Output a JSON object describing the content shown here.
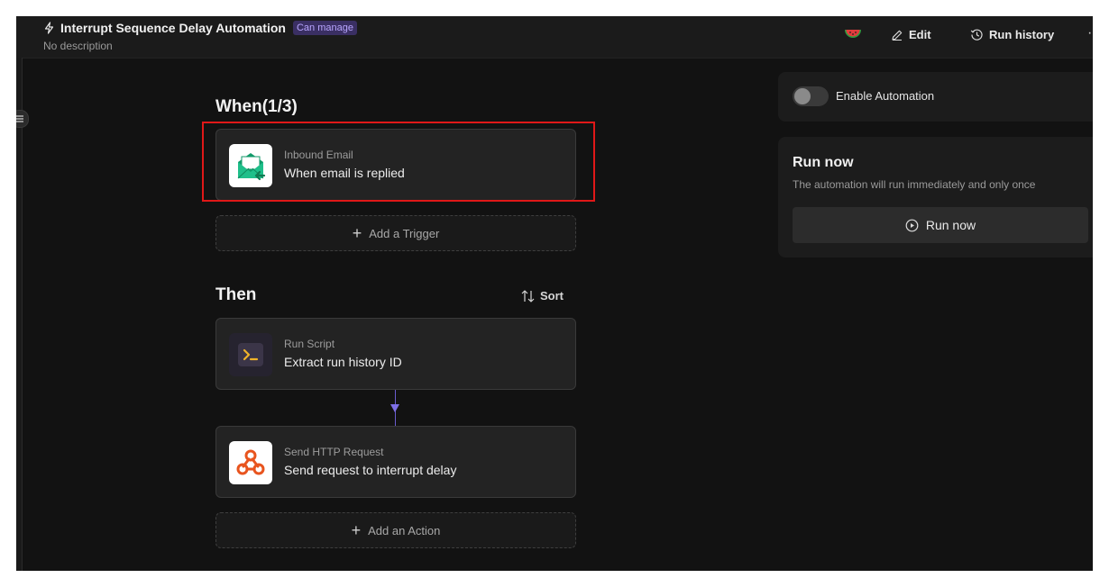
{
  "header": {
    "title": "Interrupt Sequence Delay Automation",
    "badge": "Can manage",
    "subtitle": "No description",
    "edit_label": "Edit",
    "run_history_label": "Run history",
    "more_label": "·"
  },
  "flow": {
    "when_title": "When(1/3)",
    "then_title": "Then",
    "sort_label": "Sort",
    "trigger": {
      "kind": "Inbound Email",
      "name": "When email is replied"
    },
    "add_trigger_label": "Add a Trigger",
    "actions": [
      {
        "kind": "Run Script",
        "name": "Extract run history ID"
      },
      {
        "kind": "Send HTTP Request",
        "name": "Send request to interrupt delay"
      }
    ],
    "add_action_label": "Add an Action"
  },
  "panel": {
    "enable_label": "Enable Automation",
    "enable_on": false,
    "run_now_title": "Run now",
    "run_now_desc": "The automation will run immediately and only once",
    "run_now_button": "Run now"
  },
  "colors": {
    "highlight": "#e01818",
    "badge_bg": "#3a2f63",
    "badge_text": "#b9a6ff",
    "connector": "#7e6fe6",
    "email_icon": "#1fbf8a",
    "http_icon": "#e8541e",
    "script_icon": "#f0b429"
  },
  "icons": [
    "bolt-icon",
    "watermelon-icon",
    "edit-icon",
    "history-icon",
    "menu-icon",
    "email-icon",
    "script-icon",
    "webhook-icon",
    "plus-icon",
    "sort-icon",
    "play-circle-icon"
  ]
}
